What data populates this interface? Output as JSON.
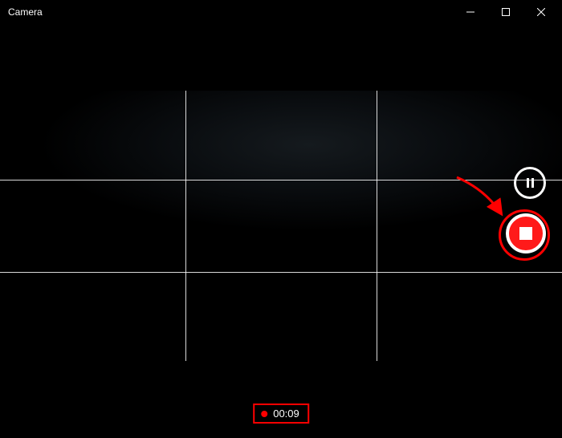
{
  "titlebar": {
    "title": "Camera"
  },
  "controls": {
    "pause_label": "Pause recording",
    "stop_label": "Stop recording"
  },
  "recording": {
    "elapsed": "00:09"
  }
}
